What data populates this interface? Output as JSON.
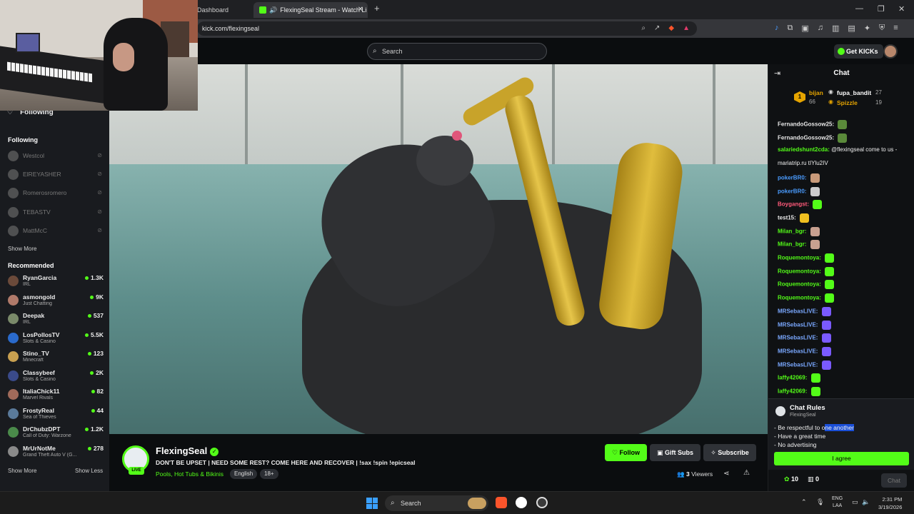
{
  "browser": {
    "prev_tab_label": "Dashboard",
    "active_tab_label": "FlexingSeal Stream - Watch Li",
    "tab_close": "✕",
    "new_tab": "+",
    "url": "kick.com/flexingseal",
    "window_controls": [
      "—",
      "❐",
      "✕"
    ]
  },
  "nav": {
    "search_placeholder": "Search",
    "get_kicks_label": "Get KICKs"
  },
  "sidebar": {
    "following_top_label": "Following",
    "following_heading": "Following",
    "following": [
      {
        "name": "Westcol"
      },
      {
        "name": "ElREYASHER"
      },
      {
        "name": "Romerosromero"
      },
      {
        "name": "TEBASTV"
      },
      {
        "name": "MattMcC"
      }
    ],
    "show_more_1": "Show More",
    "recommended_heading": "Recommended",
    "recommended": [
      {
        "name": "RyanGarcia",
        "category": "IRL",
        "viewers": "1.3K",
        "color": "#6b4a3a"
      },
      {
        "name": "asmongold",
        "category": "Just Chatting",
        "viewers": "9K",
        "color": "#b07a6a"
      },
      {
        "name": "Deepak",
        "category": "IRL",
        "viewers": "537",
        "color": "#7a8a6a"
      },
      {
        "name": "LosPollosTV",
        "category": "Slots & Casino",
        "viewers": "5.5K",
        "color": "#2a6acb"
      },
      {
        "name": "Stino_TV",
        "category": "Minecraft",
        "viewers": "123",
        "color": "#c8a050"
      },
      {
        "name": "Classybeef",
        "category": "Slots & Casino",
        "viewers": "2K",
        "color": "#3a4a8a"
      },
      {
        "name": "ItaliaChick11",
        "category": "Marvel Rivals",
        "viewers": "82",
        "color": "#a06a5a"
      },
      {
        "name": "FrostyReal",
        "category": "Sea of Thieves",
        "viewers": "44",
        "color": "#5a7a9a"
      },
      {
        "name": "DrChubzDPT",
        "category": "Call of Duty: Warzone",
        "viewers": "1.2K",
        "color": "#4a8a4a"
      },
      {
        "name": "MrUrNotMe",
        "category": "Grand Theft Auto V (G...",
        "viewers": "278",
        "color": "#8a8a8a"
      }
    ],
    "show_more_2": "Show More",
    "show_less": "Show Less"
  },
  "channel": {
    "name": "FlexingSeal",
    "live_badge": "LIVE",
    "title": "DON'T BE UPSET | NEED SOME REST? COME HERE AND RECOVER | !sax !spin !epicseal",
    "category": "Pools, Hot Tubs & Bikinis",
    "tags": [
      "English",
      "18+"
    ],
    "follow_label": "Follow",
    "gift_label": "Gift Subs",
    "subscribe_label": "Subscribe",
    "viewers_count": "3",
    "viewers_label": "Viewers"
  },
  "chat": {
    "title": "Chat",
    "leaderboard": [
      {
        "name": "bijan",
        "value": "66",
        "color": "#e5a400"
      },
      {
        "name": "fupa_bandit",
        "value": "27",
        "color": "#ffffff"
      },
      {
        "name": "Spizzle",
        "value": "19",
        "color": "#e5a400"
      }
    ],
    "messages": [
      {
        "user": "FernandoGossow25:",
        "text": "",
        "color": "#e8e8e8",
        "emote": "#5a8a3a"
      },
      {
        "user": "FernandoGossow25:",
        "text": "",
        "color": "#e8e8e8",
        "emote": "#5a8a3a"
      },
      {
        "user": "salariedshunt2cda:",
        "text": "@flexingseal come to us -",
        "color": "#53fc18",
        "emote": ""
      },
      {
        "user": "",
        "text": "mariatrip.ru tIYlu2IV",
        "color": "#e8e8e8",
        "emote": ""
      },
      {
        "user": "pokerBR0:",
        "text": "",
        "color": "#4a9cff",
        "emote": "#c89a7a"
      },
      {
        "user": "pokerBR0:",
        "text": "",
        "color": "#4a9cff",
        "emote": "#cccccc"
      },
      {
        "user": "Boygangst:",
        "text": "",
        "color": "#ff5a7a",
        "emote": "#53fc18"
      },
      {
        "user": "test15:",
        "text": "",
        "color": "#e8e8e8",
        "emote": "#f0c020"
      },
      {
        "user": "Milan_bgr:",
        "text": "",
        "color": "#53fc18",
        "emote": "#c8a090"
      },
      {
        "user": "Milan_bgr:",
        "text": "",
        "color": "#53fc18",
        "emote": "#c8a090"
      },
      {
        "user": "Roquemontoya:",
        "text": "",
        "color": "#53fc18",
        "emote": "#53fc18"
      },
      {
        "user": "Roquemontoya:",
        "text": "",
        "color": "#53fc18",
        "emote": "#53fc18"
      },
      {
        "user": "Roquemontoya:",
        "text": "",
        "color": "#53fc18",
        "emote": "#53fc18"
      },
      {
        "user": "Roquemontoya:",
        "text": "",
        "color": "#53fc18",
        "emote": "#53fc18"
      },
      {
        "user": "MRSebasLIVE:",
        "text": "",
        "color": "#7aa8ff",
        "emote": "#7a5aff"
      },
      {
        "user": "MRSebasLIVE:",
        "text": "",
        "color": "#7aa8ff",
        "emote": "#7a5aff"
      },
      {
        "user": "MRSebasLIVE:",
        "text": "",
        "color": "#7aa8ff",
        "emote": "#7a5aff"
      },
      {
        "user": "MRSebasLIVE:",
        "text": "",
        "color": "#7aa8ff",
        "emote": "#7a5aff"
      },
      {
        "user": "MRSebasLIVE:",
        "text": "",
        "color": "#7aa8ff",
        "emote": "#7a5aff"
      },
      {
        "user": "laffy42069:",
        "text": "",
        "color": "#53fc18",
        "emote": "#53fc18"
      },
      {
        "user": "laffy42069:",
        "text": "",
        "color": "#53fc18",
        "emote": "#53fc18"
      }
    ],
    "rules_title": "Chat Rules",
    "rules_channel": "FlexingSeal",
    "rules": [
      {
        "prefix": "- Be respectful to o",
        "highlight": "ne another"
      },
      {
        "prefix": "- Have a great time",
        "highlight": ""
      },
      {
        "prefix": "- No advertising",
        "highlight": ""
      }
    ],
    "agree_label": "I agree",
    "kicks_count": "10",
    "gifts_count": "0",
    "chat_button": "Chat"
  },
  "taskbar": {
    "search_placeholder": "Search",
    "lang_top": "ENG",
    "lang_bottom": "LAA",
    "time": "2:31 PM",
    "date": "3/19/2026"
  }
}
